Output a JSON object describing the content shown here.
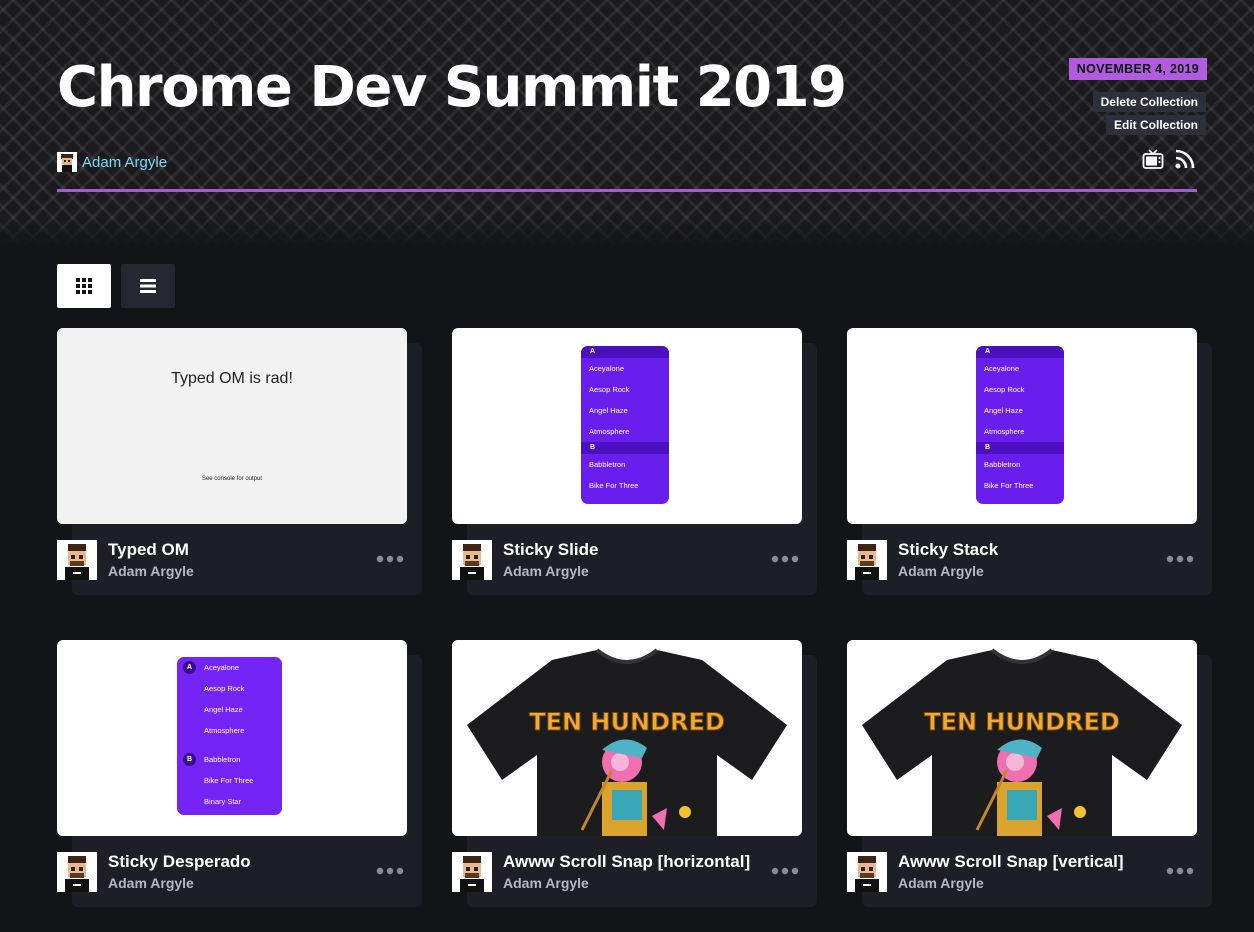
{
  "collection": {
    "title": "Chrome Dev Summit 2019",
    "author": "Adam Argyle",
    "date": "NOVEMBER 4, 2019",
    "delete_label": "Delete Collection",
    "edit_label": "Edit Collection"
  },
  "colors": {
    "accent": "#a35cd6",
    "date_badge": "#b15ce0",
    "link": "#76daff",
    "background": "#131417",
    "card": "#1e1f26",
    "sticky_purple": "#6a1eee"
  },
  "view_toggle": {
    "grid_icon": "grid-icon",
    "list_icon": "list-icon"
  },
  "pens": [
    {
      "title": "Typed OM",
      "author": "Adam Argyle",
      "preview": {
        "heading": "Typed OM is rad!",
        "note": "See console for output"
      }
    },
    {
      "title": "Sticky Slide",
      "author": "Adam Argyle",
      "preview": {
        "sections": [
          {
            "letter": "A",
            "items": [
              "Aceyalone",
              "Aesop Rock",
              "Angel Haze",
              "Atmosphere"
            ]
          },
          {
            "letter": "B",
            "items": [
              "Babbletron",
              "Bike For Three"
            ]
          }
        ]
      }
    },
    {
      "title": "Sticky Stack",
      "author": "Adam Argyle",
      "preview": {
        "sections": [
          {
            "letter": "A",
            "items": [
              "Aceyalone",
              "Aesop Rock",
              "Angel Haze",
              "Atmosphere"
            ]
          },
          {
            "letter": "B",
            "items": [
              "Babbletron",
              "Bike For Three"
            ]
          }
        ]
      }
    },
    {
      "title": "Sticky Desperado",
      "author": "Adam Argyle",
      "preview": {
        "sections": [
          {
            "letter": "A",
            "items": [
              "Aceyalone",
              "Aesop Rock",
              "Angel Haze",
              "Atmosphere"
            ]
          },
          {
            "letter": "B",
            "items": [
              "Babbletron",
              "Bike For Three",
              "Binary Star"
            ]
          }
        ]
      }
    },
    {
      "title": "Awww Scroll Snap [horizontal]",
      "author": "Adam Argyle",
      "preview": {
        "shirt_text": "TEN HUNDRED"
      }
    },
    {
      "title": "Awww Scroll Snap [vertical]",
      "author": "Adam Argyle",
      "preview": {
        "shirt_text": "TEN HUNDRED"
      }
    }
  ]
}
